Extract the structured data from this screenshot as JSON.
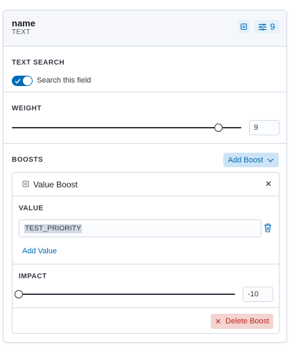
{
  "header": {
    "field_name": "name",
    "field_type": "TEXT",
    "boost_count": "9"
  },
  "text_search": {
    "title": "TEXT SEARCH",
    "toggle_label": "Search this field",
    "enabled": true
  },
  "weight": {
    "title": "WEIGHT",
    "value": "9",
    "fraction": 0.9
  },
  "boosts": {
    "title": "BOOSTS",
    "add_label": "Add Boost",
    "card": {
      "title": "Value Boost",
      "close_glyph": "✕",
      "value_title": "VALUE",
      "value": "TEST_PRIORITY",
      "add_value_label": "Add Value",
      "impact_title": "IMPACT",
      "impact_value": "-10",
      "impact_fraction": 0,
      "delete_label": "Delete Boost",
      "delete_glyph": "✕"
    }
  },
  "colors": {
    "accent": "#006bb4",
    "danger": "#bd271e",
    "border": "#d3dae6"
  }
}
